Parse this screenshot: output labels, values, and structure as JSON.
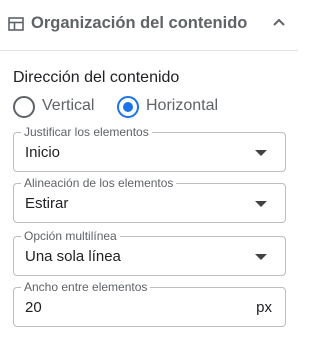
{
  "panel": {
    "title": "Organización del contenido",
    "title_icon": "layout-icon",
    "collapse_icon": "chevron-up-icon"
  },
  "direction": {
    "label": "Dirección del contenido",
    "options": [
      {
        "label": "Vertical",
        "selected": false
      },
      {
        "label": "Horizontal",
        "selected": true
      }
    ]
  },
  "justify": {
    "label": "Justificar los elementos",
    "value": "Inicio"
  },
  "align": {
    "label": "Alineación de los elementos",
    "value": "Estirar"
  },
  "multiline": {
    "label": "Opción multilínea",
    "value": "Una sola línea"
  },
  "spacing": {
    "label": "Ancho entre elementos",
    "value": "20",
    "unit": "px"
  },
  "colors": {
    "accent": "#1a73e8",
    "text": "#202124",
    "muted": "#5f6368",
    "border": "#bdbdbd"
  }
}
